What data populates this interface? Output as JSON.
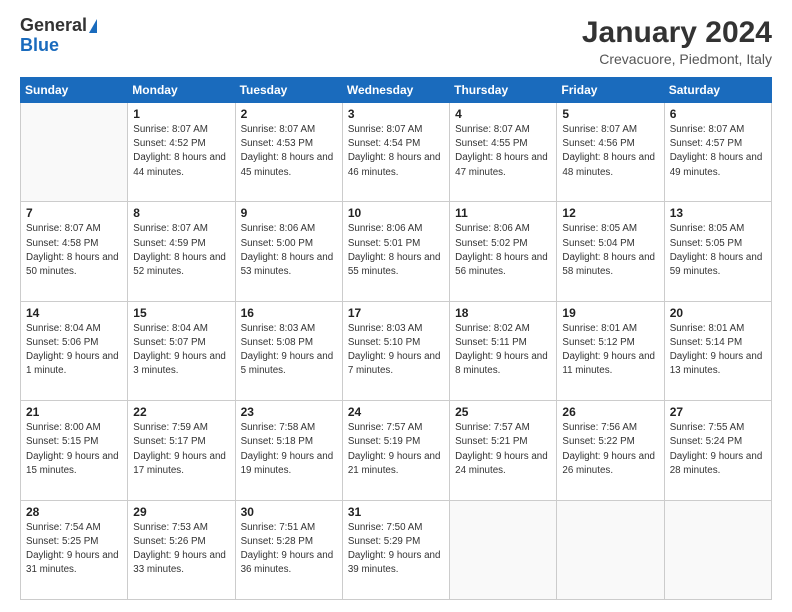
{
  "logo": {
    "general": "General",
    "blue": "Blue"
  },
  "title": "January 2024",
  "location": "Crevacuore, Piedmont, Italy",
  "days_of_week": [
    "Sunday",
    "Monday",
    "Tuesday",
    "Wednesday",
    "Thursday",
    "Friday",
    "Saturday"
  ],
  "weeks": [
    [
      {
        "day": "",
        "sunrise": "",
        "sunset": "",
        "daylight": ""
      },
      {
        "day": "1",
        "sunrise": "Sunrise: 8:07 AM",
        "sunset": "Sunset: 4:52 PM",
        "daylight": "Daylight: 8 hours and 44 minutes."
      },
      {
        "day": "2",
        "sunrise": "Sunrise: 8:07 AM",
        "sunset": "Sunset: 4:53 PM",
        "daylight": "Daylight: 8 hours and 45 minutes."
      },
      {
        "day": "3",
        "sunrise": "Sunrise: 8:07 AM",
        "sunset": "Sunset: 4:54 PM",
        "daylight": "Daylight: 8 hours and 46 minutes."
      },
      {
        "day": "4",
        "sunrise": "Sunrise: 8:07 AM",
        "sunset": "Sunset: 4:55 PM",
        "daylight": "Daylight: 8 hours and 47 minutes."
      },
      {
        "day": "5",
        "sunrise": "Sunrise: 8:07 AM",
        "sunset": "Sunset: 4:56 PM",
        "daylight": "Daylight: 8 hours and 48 minutes."
      },
      {
        "day": "6",
        "sunrise": "Sunrise: 8:07 AM",
        "sunset": "Sunset: 4:57 PM",
        "daylight": "Daylight: 8 hours and 49 minutes."
      }
    ],
    [
      {
        "day": "7",
        "sunrise": "Sunrise: 8:07 AM",
        "sunset": "Sunset: 4:58 PM",
        "daylight": "Daylight: 8 hours and 50 minutes."
      },
      {
        "day": "8",
        "sunrise": "Sunrise: 8:07 AM",
        "sunset": "Sunset: 4:59 PM",
        "daylight": "Daylight: 8 hours and 52 minutes."
      },
      {
        "day": "9",
        "sunrise": "Sunrise: 8:06 AM",
        "sunset": "Sunset: 5:00 PM",
        "daylight": "Daylight: 8 hours and 53 minutes."
      },
      {
        "day": "10",
        "sunrise": "Sunrise: 8:06 AM",
        "sunset": "Sunset: 5:01 PM",
        "daylight": "Daylight: 8 hours and 55 minutes."
      },
      {
        "day": "11",
        "sunrise": "Sunrise: 8:06 AM",
        "sunset": "Sunset: 5:02 PM",
        "daylight": "Daylight: 8 hours and 56 minutes."
      },
      {
        "day": "12",
        "sunrise": "Sunrise: 8:05 AM",
        "sunset": "Sunset: 5:04 PM",
        "daylight": "Daylight: 8 hours and 58 minutes."
      },
      {
        "day": "13",
        "sunrise": "Sunrise: 8:05 AM",
        "sunset": "Sunset: 5:05 PM",
        "daylight": "Daylight: 8 hours and 59 minutes."
      }
    ],
    [
      {
        "day": "14",
        "sunrise": "Sunrise: 8:04 AM",
        "sunset": "Sunset: 5:06 PM",
        "daylight": "Daylight: 9 hours and 1 minute."
      },
      {
        "day": "15",
        "sunrise": "Sunrise: 8:04 AM",
        "sunset": "Sunset: 5:07 PM",
        "daylight": "Daylight: 9 hours and 3 minutes."
      },
      {
        "day": "16",
        "sunrise": "Sunrise: 8:03 AM",
        "sunset": "Sunset: 5:08 PM",
        "daylight": "Daylight: 9 hours and 5 minutes."
      },
      {
        "day": "17",
        "sunrise": "Sunrise: 8:03 AM",
        "sunset": "Sunset: 5:10 PM",
        "daylight": "Daylight: 9 hours and 7 minutes."
      },
      {
        "day": "18",
        "sunrise": "Sunrise: 8:02 AM",
        "sunset": "Sunset: 5:11 PM",
        "daylight": "Daylight: 9 hours and 8 minutes."
      },
      {
        "day": "19",
        "sunrise": "Sunrise: 8:01 AM",
        "sunset": "Sunset: 5:12 PM",
        "daylight": "Daylight: 9 hours and 11 minutes."
      },
      {
        "day": "20",
        "sunrise": "Sunrise: 8:01 AM",
        "sunset": "Sunset: 5:14 PM",
        "daylight": "Daylight: 9 hours and 13 minutes."
      }
    ],
    [
      {
        "day": "21",
        "sunrise": "Sunrise: 8:00 AM",
        "sunset": "Sunset: 5:15 PM",
        "daylight": "Daylight: 9 hours and 15 minutes."
      },
      {
        "day": "22",
        "sunrise": "Sunrise: 7:59 AM",
        "sunset": "Sunset: 5:17 PM",
        "daylight": "Daylight: 9 hours and 17 minutes."
      },
      {
        "day": "23",
        "sunrise": "Sunrise: 7:58 AM",
        "sunset": "Sunset: 5:18 PM",
        "daylight": "Daylight: 9 hours and 19 minutes."
      },
      {
        "day": "24",
        "sunrise": "Sunrise: 7:57 AM",
        "sunset": "Sunset: 5:19 PM",
        "daylight": "Daylight: 9 hours and 21 minutes."
      },
      {
        "day": "25",
        "sunrise": "Sunrise: 7:57 AM",
        "sunset": "Sunset: 5:21 PM",
        "daylight": "Daylight: 9 hours and 24 minutes."
      },
      {
        "day": "26",
        "sunrise": "Sunrise: 7:56 AM",
        "sunset": "Sunset: 5:22 PM",
        "daylight": "Daylight: 9 hours and 26 minutes."
      },
      {
        "day": "27",
        "sunrise": "Sunrise: 7:55 AM",
        "sunset": "Sunset: 5:24 PM",
        "daylight": "Daylight: 9 hours and 28 minutes."
      }
    ],
    [
      {
        "day": "28",
        "sunrise": "Sunrise: 7:54 AM",
        "sunset": "Sunset: 5:25 PM",
        "daylight": "Daylight: 9 hours and 31 minutes."
      },
      {
        "day": "29",
        "sunrise": "Sunrise: 7:53 AM",
        "sunset": "Sunset: 5:26 PM",
        "daylight": "Daylight: 9 hours and 33 minutes."
      },
      {
        "day": "30",
        "sunrise": "Sunrise: 7:51 AM",
        "sunset": "Sunset: 5:28 PM",
        "daylight": "Daylight: 9 hours and 36 minutes."
      },
      {
        "day": "31",
        "sunrise": "Sunrise: 7:50 AM",
        "sunset": "Sunset: 5:29 PM",
        "daylight": "Daylight: 9 hours and 39 minutes."
      },
      {
        "day": "",
        "sunrise": "",
        "sunset": "",
        "daylight": ""
      },
      {
        "day": "",
        "sunrise": "",
        "sunset": "",
        "daylight": ""
      },
      {
        "day": "",
        "sunrise": "",
        "sunset": "",
        "daylight": ""
      }
    ]
  ]
}
